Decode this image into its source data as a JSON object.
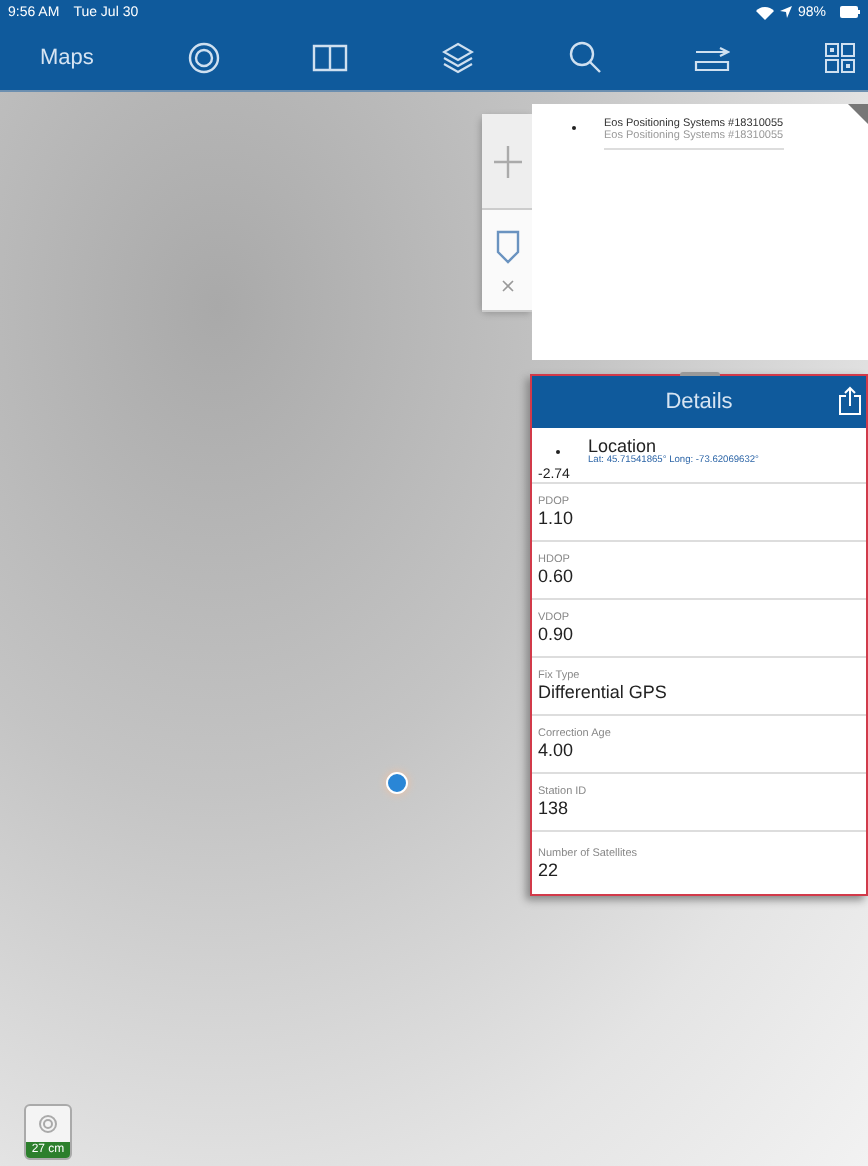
{
  "status_bar": {
    "time": "9:56 AM",
    "date": "Tue Jul 30",
    "battery": "98%"
  },
  "nav_bar": {
    "title": "Maps"
  },
  "side_tabs": [
    {
      "kind": "add",
      "selected": false
    },
    {
      "kind": "marker",
      "selected": true
    }
  ],
  "device_list": [
    {
      "name": "Eos Positioning Systems #18310055",
      "subtitle": "Eos Positioning Systems #18310055"
    }
  ],
  "details": {
    "title": "Details",
    "location": {
      "label": "Location",
      "coords": "Lat: 45.71541865° Long: -73.62069632°"
    },
    "partial_value": "-2.74",
    "fields": [
      {
        "label": "PDOP",
        "value": "1.10"
      },
      {
        "label": "HDOP",
        "value": "0.60"
      },
      {
        "label": "VDOP",
        "value": "0.90"
      },
      {
        "label": "Fix Type",
        "value": "Differential GPS"
      },
      {
        "label": "Correction Age",
        "value": "4.00"
      },
      {
        "label": "Station ID",
        "value": "138"
      },
      {
        "label": "Number of Satellites",
        "value": "22"
      }
    ]
  },
  "scale": {
    "label": "27 cm"
  }
}
